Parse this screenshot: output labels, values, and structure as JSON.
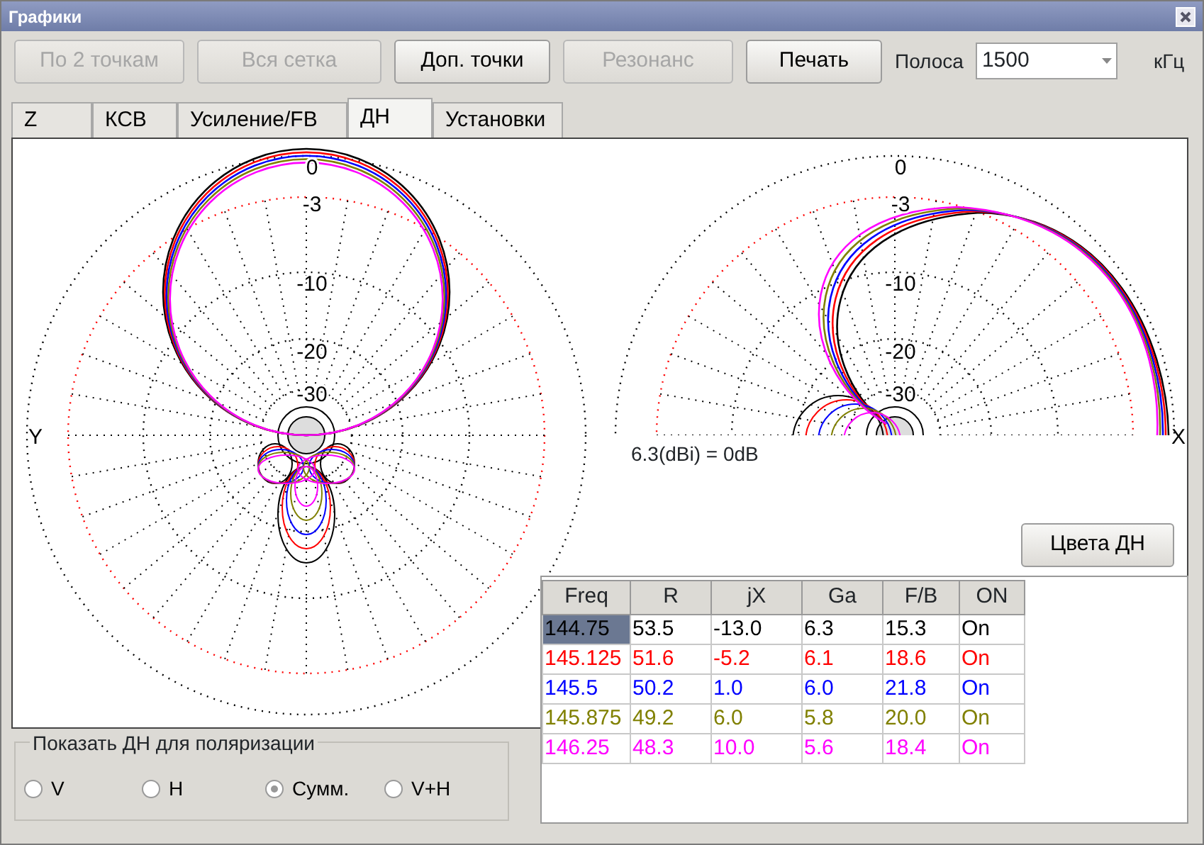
{
  "window": {
    "title": "Графики"
  },
  "toolbar": {
    "buttons": [
      {
        "label": "По 2 точкам",
        "disabled": true
      },
      {
        "label": "Вся сетка",
        "disabled": true
      },
      {
        "label": "Доп. точки",
        "disabled": false
      },
      {
        "label": "Резонанс",
        "disabled": true
      },
      {
        "label": "Печать",
        "disabled": false
      }
    ],
    "band_label": "Полоса",
    "band_value": "1500",
    "band_unit": "кГц"
  },
  "tabs": [
    {
      "label": "Z",
      "selected": false
    },
    {
      "label": "КСВ",
      "selected": false
    },
    {
      "label": "Усиление/FB",
      "selected": false
    },
    {
      "label": "ДН",
      "selected": true
    },
    {
      "label": "Установки",
      "selected": false
    }
  ],
  "plots": [
    {
      "axis_label": "Y",
      "ring_labels": [
        "0",
        "-3",
        "-10",
        "-20",
        "-30"
      ]
    },
    {
      "axis_label": "X",
      "ring_labels": [
        "0",
        "-3",
        "-10",
        "-20",
        "-30"
      ]
    }
  ],
  "reference_note": "6.3(dBi) = 0dB",
  "colors_button": "Цвета ДН",
  "table": {
    "columns": [
      "Freq",
      "R",
      "jX",
      "Ga",
      "F/B",
      "ON"
    ],
    "rows": [
      {
        "cells": [
          "144.75",
          "53.5",
          "-13.0",
          "6.3",
          "15.3",
          "On"
        ],
        "color": "#000000",
        "selected": true
      },
      {
        "cells": [
          "145.125",
          "51.6",
          "-5.2",
          "6.1",
          "18.6",
          "On"
        ],
        "color": "#ff0000",
        "selected": false
      },
      {
        "cells": [
          "145.5",
          "50.2",
          "1.0",
          "6.0",
          "21.8",
          "On"
        ],
        "color": "#0000ff",
        "selected": false
      },
      {
        "cells": [
          "145.875",
          "49.2",
          "6.0",
          "5.8",
          "20.0",
          "On"
        ],
        "color": "#808000",
        "selected": false
      },
      {
        "cells": [
          "146.25",
          "48.3",
          "10.0",
          "5.6",
          "18.4",
          "On"
        ],
        "color": "#ff00ff",
        "selected": false
      }
    ]
  },
  "polarization": {
    "legend": "Показать ДН для поляризации",
    "options": [
      {
        "label": "V",
        "selected": false
      },
      {
        "label": "H",
        "selected": false
      },
      {
        "label": "Сумм.",
        "selected": true
      },
      {
        "label": "V+H",
        "selected": false
      }
    ]
  }
}
